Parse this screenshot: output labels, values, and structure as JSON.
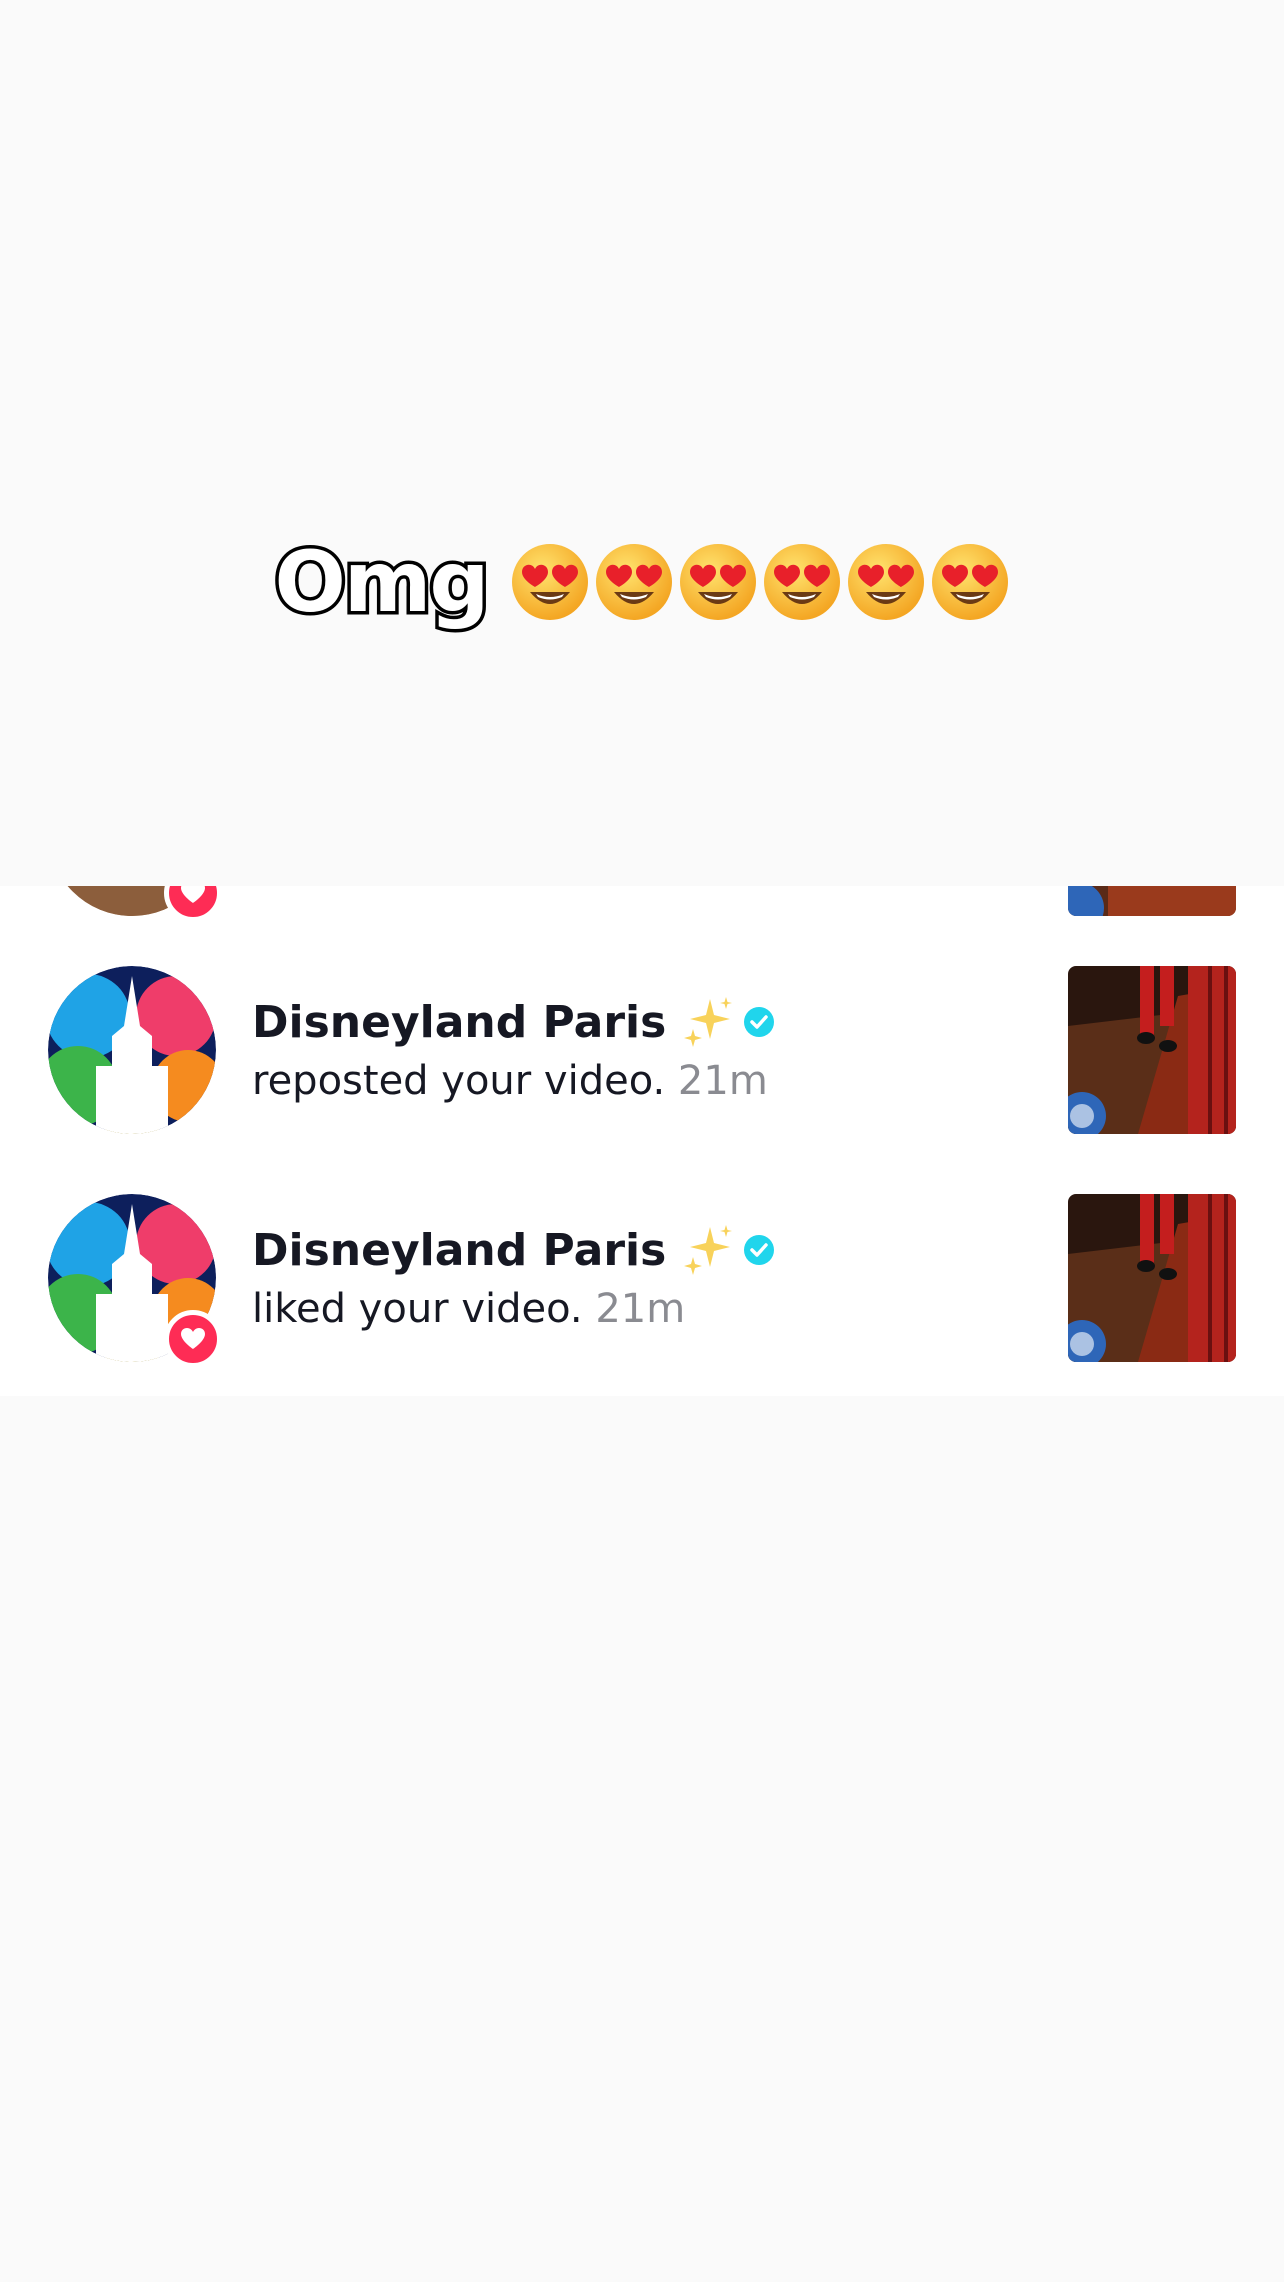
{
  "caption": {
    "text": "Omg",
    "emoji_count": 6,
    "emoji_name": "smiling-face-with-heart-eyes"
  },
  "notifications": [
    {
      "name": "Disneyland Paris",
      "name_emoji": "✨",
      "verified": true,
      "action": "reposted your video.",
      "time": "21m",
      "badge": null
    },
    {
      "name": "Disneyland Paris",
      "name_emoji": "✨",
      "verified": true,
      "action": "liked your video.",
      "time": "21m",
      "badge": "heart"
    }
  ],
  "colors": {
    "background": "#fafafa",
    "panel": "#ffffff",
    "text_primary": "#161823",
    "text_secondary": "#8a8b91",
    "heart_badge": "#fe2c55",
    "verified_badge": "#20d5ec"
  }
}
